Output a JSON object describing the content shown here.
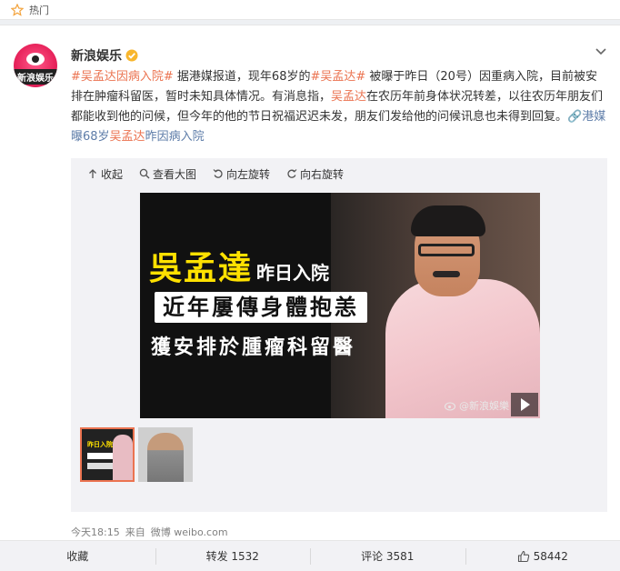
{
  "hot": {
    "label": "热门"
  },
  "post": {
    "author": "新浪娱乐",
    "avatar_text": "新浪娱乐",
    "text": {
      "tag1": "#吴孟达因病入院#",
      "p1": " 据港媒报道，现年68岁的",
      "tag2": "#吴孟达#",
      "p2": " 被曝于昨日（20号）因重病入院，目前被安排在肿瘤科留医，暂时未知具体情况。有消息指，",
      "name1": "吴孟达",
      "p3": "在农历年前身体状况转差，以往农历年朋友们都能收到他的问候，但今年的他的节日祝福迟迟未发，朋友们发给他的问候讯息也未得到回复。",
      "link_icon": "🔗",
      "link_pre": "港媒曝68岁",
      "link_name": "吴孟达",
      "link_post": "昨因病入院"
    },
    "media_toolbar": {
      "collapse": "收起",
      "view_large": "查看大图",
      "rotate_left": "向左旋转",
      "rotate_right": "向右旋转"
    },
    "image": {
      "headline_yellow": "吳孟達",
      "headline_white": "昨日入院",
      "line2": "近年屢傳身體抱恙",
      "line3": "獲安排於腫瘤科留醫",
      "watermark": "@新浪娛樂"
    },
    "thumbs": {
      "t1_yellow": "昨日入院"
    },
    "meta": {
      "time": "今天18:15",
      "from_label": "来自",
      "source": "微博 weibo.com"
    },
    "actions": {
      "favorite": "收藏",
      "repost": "转发 1532",
      "comment": "评论 3581",
      "like": "58442"
    }
  },
  "colors": {
    "accent": "#eb7350",
    "link_blue": "#5d7ca8",
    "headline_yellow": "#ffe100"
  }
}
